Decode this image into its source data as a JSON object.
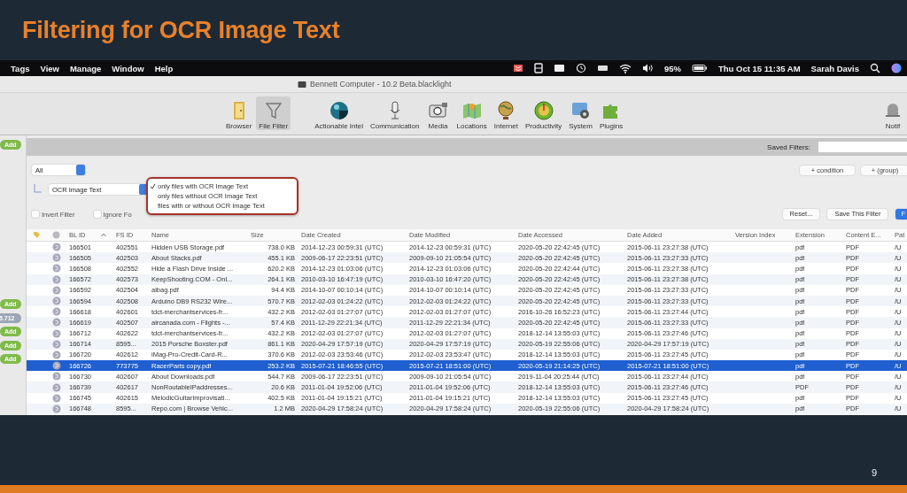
{
  "slide": {
    "title": "Filtering for OCR Image Text",
    "page_number": "9"
  },
  "menubar": {
    "menus": [
      "Tags",
      "View",
      "Manage",
      "Window",
      "Help"
    ],
    "battery": "95%",
    "clock": "Thu Oct 15 11:35 AM",
    "user": "Sarah Davis"
  },
  "window": {
    "title": "Bennett Computer - 10.2 Beta.blacklight"
  },
  "toolbar": {
    "items": [
      {
        "label": "Browser",
        "selected": false
      },
      {
        "label": "File Filter",
        "selected": true
      },
      {
        "label": "Actionable Intel",
        "selected": false
      },
      {
        "label": "Communication",
        "selected": false
      },
      {
        "label": "Media",
        "selected": false
      },
      {
        "label": "Locations",
        "selected": false
      },
      {
        "label": "Internet",
        "selected": false
      },
      {
        "label": "Productivity",
        "selected": false
      },
      {
        "label": "System",
        "selected": false
      },
      {
        "label": "Plugins",
        "selected": false
      },
      {
        "label": "Notif",
        "selected": false
      }
    ]
  },
  "sidebar": {
    "top_badge": "Add",
    "badges": [
      {
        "kind": "add",
        "label": "Add"
      },
      {
        "kind": "count",
        "label": "5.712"
      },
      {
        "kind": "add",
        "label": "Add"
      },
      {
        "kind": "add",
        "label": "Add"
      },
      {
        "kind": "add",
        "label": "Add"
      }
    ]
  },
  "saved_filters": {
    "label": "Saved Filters:"
  },
  "filter": {
    "scope": "All",
    "field": "OCR Image Text",
    "options": [
      {
        "label": "only files with OCR Image Text",
        "selected": true
      },
      {
        "label": "only files without OCR Image Text",
        "selected": false
      },
      {
        "label": "files with or without OCR Image Text",
        "selected": false
      }
    ],
    "add_buttons": [
      "+ condition",
      "+ (group)"
    ],
    "checkboxes": [
      {
        "label": "Invert Filter",
        "checked": false
      },
      {
        "label": "Ignore Fo",
        "checked": false
      }
    ],
    "buttons": [
      {
        "label": "Reset...",
        "kind": "plain"
      },
      {
        "label": "Save This Filter",
        "kind": "plain"
      },
      {
        "label": "F",
        "kind": "primary"
      }
    ]
  },
  "table": {
    "columns": [
      {
        "label": "BL ID",
        "sorted": true
      },
      {
        "label": "FS ID",
        "sorted": false
      },
      {
        "label": "Name",
        "sorted": false
      },
      {
        "label": "Size",
        "sorted": false
      },
      {
        "label": "Date Created",
        "sorted": false
      },
      {
        "label": "Date Modified",
        "sorted": false
      },
      {
        "label": "Date Accessed",
        "sorted": false
      },
      {
        "label": "Date Added",
        "sorted": false
      },
      {
        "label": "Version Index",
        "sorted": false
      },
      {
        "label": "Extension",
        "sorted": false
      },
      {
        "label": "Content E...",
        "sorted": false
      },
      {
        "label": "Pat",
        "sorted": false
      }
    ],
    "rows": [
      {
        "bl_id": "166501",
        "fs_id": "402551",
        "name": "Hidden USB Storage.pdf",
        "size": "738.0 KB",
        "created": "2014-12-23 00:59:31 (UTC)",
        "modified": "2014-12-23 00:59:31 (UTC)",
        "accessed": "2020-05-20 22:42:45 (UTC)",
        "added": "2015-06-11 23:27:38 (UTC)",
        "extension": "pdf",
        "content": "PDF",
        "path": "/U",
        "selected": false
      },
      {
        "bl_id": "166505",
        "fs_id": "402503",
        "name": "About Stacks.pdf",
        "size": "455.1 KB",
        "created": "2009-06-17 22:23:51 (UTC)",
        "modified": "2009-09-10 21:05:54 (UTC)",
        "accessed": "2020-05-20 22:42:45 (UTC)",
        "added": "2015-06-11 23:27:33 (UTC)",
        "extension": "pdf",
        "content": "PDF",
        "path": "/U",
        "selected": false
      },
      {
        "bl_id": "166508",
        "fs_id": "402552",
        "name": "Hide a Flash Drive Inside ...",
        "size": "620.2 KB",
        "created": "2014-12-23 01:03:06 (UTC)",
        "modified": "2014-12-23 01:03:06 (UTC)",
        "accessed": "2020-05-20 22:42:44 (UTC)",
        "added": "2015-06-11 23:27:38 (UTC)",
        "extension": "pdf",
        "content": "PDF",
        "path": "/U",
        "selected": false
      },
      {
        "bl_id": "166572",
        "fs_id": "402573",
        "name": "KeepShooting.COM - Onl...",
        "size": "264.1 KB",
        "created": "2010-03-10 16:47:19 (UTC)",
        "modified": "2010-03-10 16:47:20 (UTC)",
        "accessed": "2020-05-20 22:42:45 (UTC)",
        "added": "2015-06-11 23:27:38 (UTC)",
        "extension": "pdf",
        "content": "PDF",
        "path": "/U",
        "selected": false
      },
      {
        "bl_id": "166592",
        "fs_id": "402504",
        "name": "aibag.pdf",
        "size": "94.4 KB",
        "created": "2014-10-07 00:10:14 (UTC)",
        "modified": "2014-10-07 00:10:14 (UTC)",
        "accessed": "2020-05-20 22:42:45 (UTC)",
        "added": "2015-06-11 23:27:33 (UTC)",
        "extension": "pdf",
        "content": "PDF",
        "path": "/U",
        "selected": false
      },
      {
        "bl_id": "166594",
        "fs_id": "402508",
        "name": "Arduino DB9 RS232 Wire...",
        "size": "570.7 KB",
        "created": "2012-02-03 01:24:22 (UTC)",
        "modified": "2012-02-03 01:24:22 (UTC)",
        "accessed": "2020-05-20 22:42:45 (UTC)",
        "added": "2015-06-11 23:27:33 (UTC)",
        "extension": "pdf",
        "content": "PDF",
        "path": "/U",
        "selected": false
      },
      {
        "bl_id": "166618",
        "fs_id": "402601",
        "name": "tdct-merchantservices-fr...",
        "size": "432.2 KB",
        "created": "2012-02-03 01:27:07 (UTC)",
        "modified": "2012-02-03 01:27:07 (UTC)",
        "accessed": "2016-10-26 16:52:23 (UTC)",
        "added": "2015-06-11 23:27:44 (UTC)",
        "extension": "pdf",
        "content": "PDF",
        "path": "/U",
        "selected": false
      },
      {
        "bl_id": "166619",
        "fs_id": "402507",
        "name": "aircanada.com - Flights -...",
        "size": "57.4 KB",
        "created": "2011-12-29 22:21:34 (UTC)",
        "modified": "2011-12-29 22:21:34 (UTC)",
        "accessed": "2020-05-20 22:42:45 (UTC)",
        "added": "2015-06-11 23:27:33 (UTC)",
        "extension": "pdf",
        "content": "PDF",
        "path": "/U",
        "selected": false
      },
      {
        "bl_id": "166712",
        "fs_id": "402622",
        "name": "tdct-merchantservices-fr...",
        "size": "432.2 KB",
        "created": "2012-02-03 01:27:07 (UTC)",
        "modified": "2012-02-03 01:27:07 (UTC)",
        "accessed": "2018-12-14 13:55:03 (UTC)",
        "added": "2015-06-11 23:27:46 (UTC)",
        "extension": "pdf",
        "content": "PDF",
        "path": "/U",
        "selected": false
      },
      {
        "bl_id": "166714",
        "fs_id": "8595...",
        "name": "2015 Porsche Boxster.pdf",
        "size": "861.1 KB",
        "created": "2020-04-29 17:57:19 (UTC)",
        "modified": "2020-04-29 17:57:19 (UTC)",
        "accessed": "2020-05-19 22:55:06 (UTC)",
        "added": "2020-04-29 17:57:19 (UTC)",
        "extension": "pdf",
        "content": "PDF",
        "path": "/U",
        "selected": false
      },
      {
        "bl_id": "166720",
        "fs_id": "402612",
        "name": "iMag-Pro-Credit-Card-R...",
        "size": "370.6 KB",
        "created": "2012-02-03 23:53:46 (UTC)",
        "modified": "2012-02-03 23:53:47 (UTC)",
        "accessed": "2018-12-14 13:55:03 (UTC)",
        "added": "2015-06-11 23:27:45 (UTC)",
        "extension": "pdf",
        "content": "PDF",
        "path": "/U",
        "selected": false
      },
      {
        "bl_id": "166726",
        "fs_id": "773775",
        "name": "RacerParts copy.pdf",
        "size": "253.2 KB",
        "created": "2015-07-21 18:46:55 (UTC)",
        "modified": "2015-07-21 18:51:00 (UTC)",
        "accessed": "2020-05-19 21:14:25 (UTC)",
        "added": "2015-07-21 18:51:00 (UTC)",
        "extension": "pdf",
        "content": "PDF",
        "path": "/U",
        "selected": true
      },
      {
        "bl_id": "166730",
        "fs_id": "402607",
        "name": "About Downloads.pdf",
        "size": "544.7 KB",
        "created": "2009-06-17 22:23:51 (UTC)",
        "modified": "2009-09-10 21:05:54 (UTC)",
        "accessed": "2019-11-04 20:25:44 (UTC)",
        "added": "2015-06-11 23:27:44 (UTC)",
        "extension": "pdf",
        "content": "PDF",
        "path": "/U",
        "selected": false
      },
      {
        "bl_id": "166739",
        "fs_id": "402617",
        "name": "NonRoutableIPaddresses...",
        "size": "20.6 KB",
        "created": "2011-01-04 19:52:06 (UTC)",
        "modified": "2011-01-04 19:52:06 (UTC)",
        "accessed": "2018-12-14 13:55:03 (UTC)",
        "added": "2015-06-11 23:27:46 (UTC)",
        "extension": "PDF",
        "content": "PDF",
        "path": "/U",
        "selected": false
      },
      {
        "bl_id": "166745",
        "fs_id": "402615",
        "name": "MelodicGuitarImprovisati...",
        "size": "402.5 KB",
        "created": "2011-01-04 19:15:21 (UTC)",
        "modified": "2011-01-04 19:15:21 (UTC)",
        "accessed": "2018-12-14 13:55:03 (UTC)",
        "added": "2015-06-11 23:27:45 (UTC)",
        "extension": "pdf",
        "content": "PDF",
        "path": "/U",
        "selected": false
      },
      {
        "bl_id": "166748",
        "fs_id": "8595...",
        "name": "Repo.com | Browse Vehic...",
        "size": "1.2 MB",
        "created": "2020-04-29 17:58:24 (UTC)",
        "modified": "2020-04-29 17:58:24 (UTC)",
        "accessed": "2020-05-19 22:55:06 (UTC)",
        "added": "2020-04-29 17:58:24 (UTC)",
        "extension": "pdf",
        "content": "PDF",
        "path": "/U",
        "selected": false
      }
    ]
  }
}
